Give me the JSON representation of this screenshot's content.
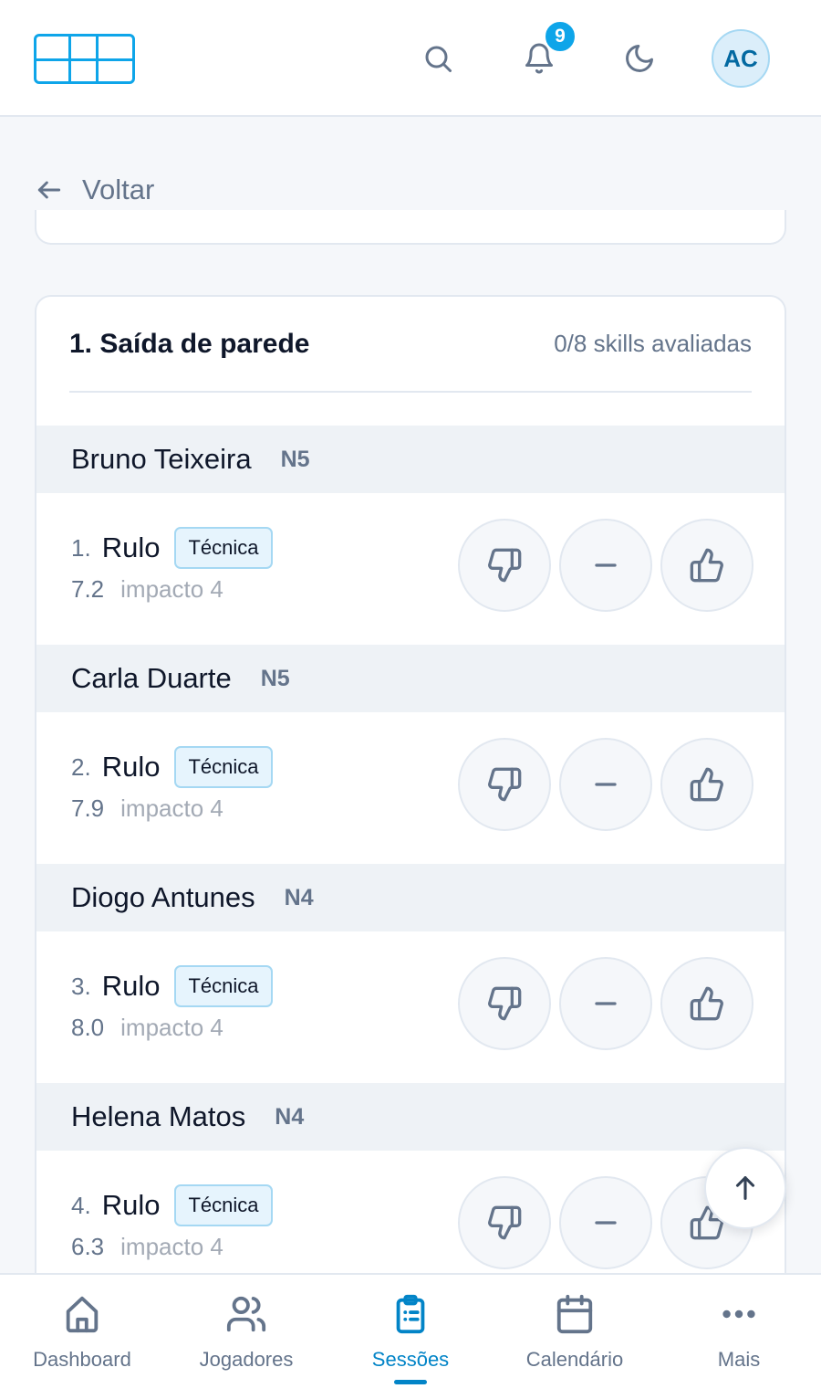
{
  "header": {
    "logo": "app-logo",
    "notifications_count": "9",
    "avatar_initials": "AC",
    "accent_color": "#0ea5e9"
  },
  "back_label": "Voltar",
  "exercise": {
    "title": "1. Saída de parede",
    "progress_text": "0/8 skills avaliadas",
    "groups": [
      {
        "player": "Bruno Teixeira",
        "level": "N5",
        "skill_num": "1.",
        "skill": "Rulo",
        "tag": "Técnica",
        "score": "7.2",
        "impact": "impacto 4"
      },
      {
        "player": "Carla Duarte",
        "level": "N5",
        "skill_num": "2.",
        "skill": "Rulo",
        "tag": "Técnica",
        "score": "7.9",
        "impact": "impacto 4"
      },
      {
        "player": "Diogo Antunes",
        "level": "N4",
        "skill_num": "3.",
        "skill": "Rulo",
        "tag": "Técnica",
        "score": "8.0",
        "impact": "impacto 4"
      },
      {
        "player": "Helena Matos",
        "level": "N4",
        "skill_num": "4.",
        "skill": "Rulo",
        "tag": "Técnica",
        "score": "6.3",
        "impact": "impacto 4"
      }
    ]
  },
  "bottom_nav": {
    "items": [
      {
        "label": "Dashboard",
        "icon": "home-icon"
      },
      {
        "label": "Jogadores",
        "icon": "users-icon"
      },
      {
        "label": "Sessões",
        "icon": "clipboard-icon"
      },
      {
        "label": "Calendário",
        "icon": "calendar-icon"
      },
      {
        "label": "Mais",
        "icon": "more-icon"
      }
    ],
    "active": "Sessões"
  }
}
